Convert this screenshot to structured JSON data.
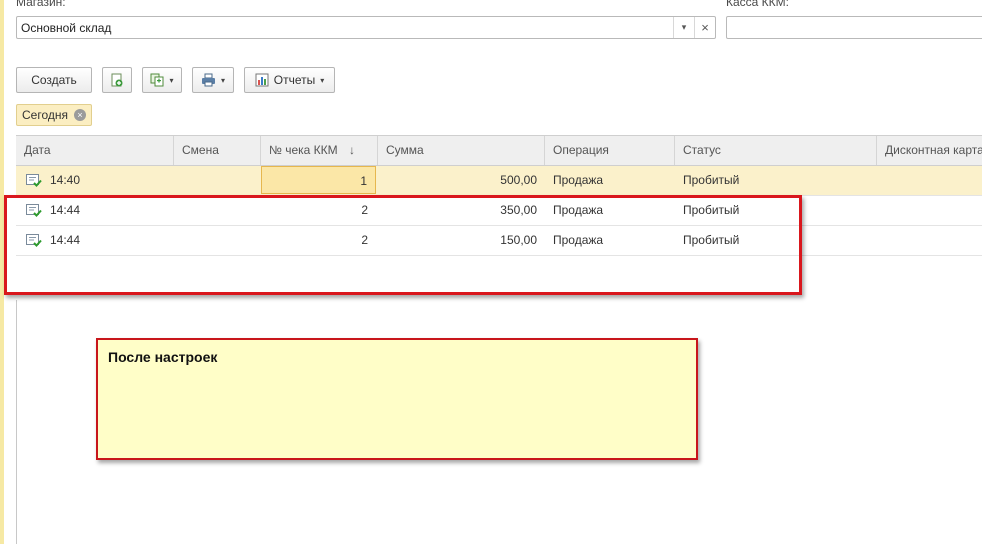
{
  "filters": {
    "store_label": "Магазин:",
    "store_value": "Основной склад",
    "store_dropdown_glyph": "▾",
    "store_clear_glyph": "×",
    "kkm_label": "Касса ККМ:",
    "kkm_value": ""
  },
  "toolbar": {
    "create_label": "Создать",
    "reports_label": "Отчеты",
    "caret": "▾"
  },
  "period_chip": {
    "label": "Сегодня",
    "close_glyph": "×"
  },
  "table": {
    "columns": [
      "Дата",
      "Смена",
      "№ чека ККМ",
      "Сумма",
      "Операция",
      "Статус",
      "Дисконтная карта"
    ],
    "sort_glyph": "↓",
    "rows": [
      {
        "time": "14:40",
        "shift": "",
        "receipt": "1",
        "sum": "500,00",
        "operation": "Продажа",
        "status": "Пробитый",
        "card": ""
      },
      {
        "time": "14:44",
        "shift": "",
        "receipt": "2",
        "sum": "350,00",
        "operation": "Продажа",
        "status": "Пробитый",
        "card": ""
      },
      {
        "time": "14:44",
        "shift": "",
        "receipt": "2",
        "sum": "150,00",
        "operation": "Продажа",
        "status": "Пробитый",
        "card": ""
      }
    ]
  },
  "annotation": {
    "text": "После настроек"
  },
  "colors": {
    "highlight_red": "#d9171d",
    "note_bg": "#fffec8",
    "selected_row": "#fbf1cb"
  }
}
